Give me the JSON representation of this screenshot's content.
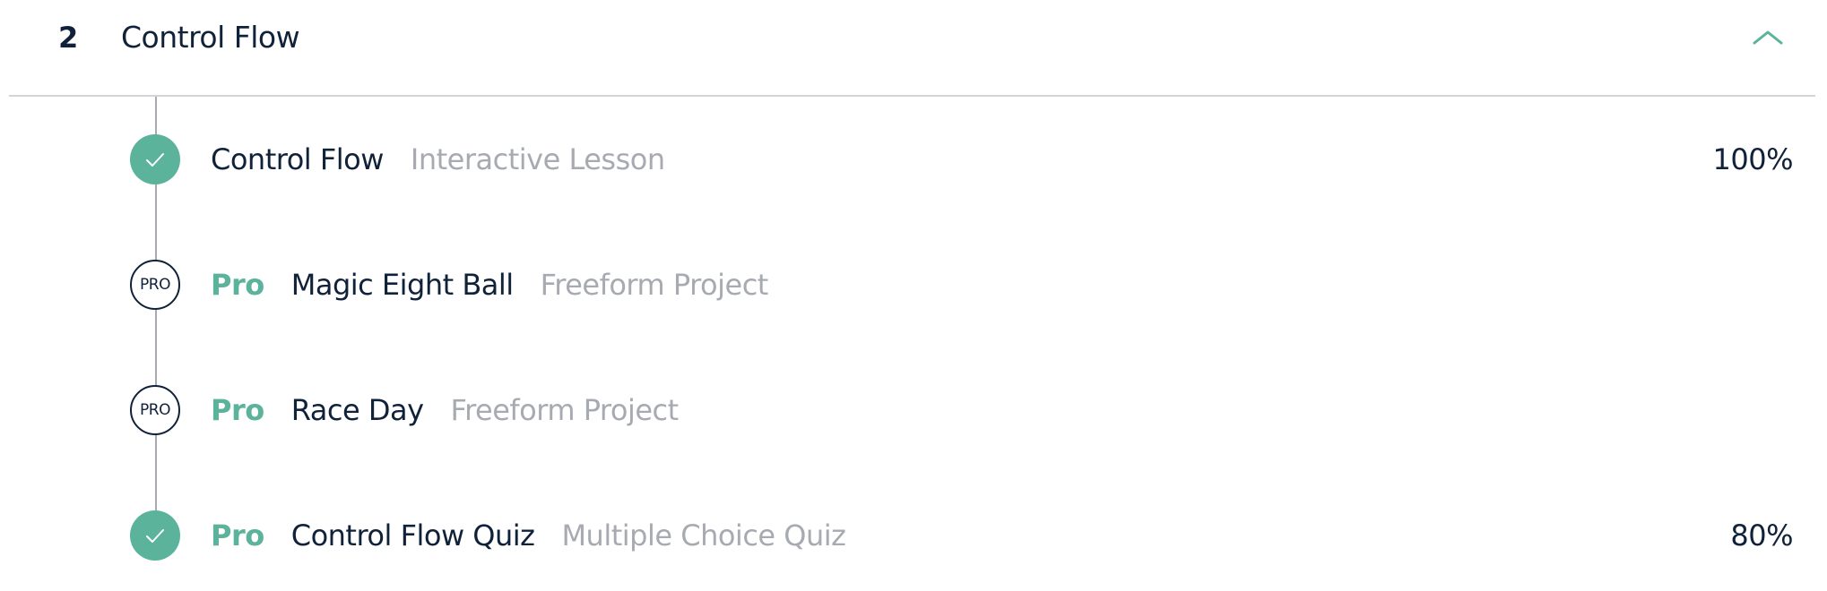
{
  "section": {
    "number": "2",
    "title": "Control Flow",
    "toggle_icon": "chevron-up-icon"
  },
  "lessons": [
    {
      "status": "complete",
      "status_icon": "checkmark-icon",
      "pro_label": "",
      "title": "Control Flow",
      "type": "Interactive Lesson",
      "progress": "100%"
    },
    {
      "status": "pro",
      "status_icon": "pro-badge-icon",
      "badge_text": "PRO",
      "pro_label": "Pro",
      "title": "Magic Eight Ball",
      "type": "Freeform Project",
      "progress": ""
    },
    {
      "status": "pro",
      "status_icon": "pro-badge-icon",
      "badge_text": "PRO",
      "pro_label": "Pro",
      "title": "Race Day",
      "type": "Freeform Project",
      "progress": ""
    },
    {
      "status": "complete",
      "status_icon": "checkmark-icon",
      "pro_label": "Pro",
      "title": "Control Flow Quiz",
      "type": "Multiple Choice Quiz",
      "progress": "80%"
    }
  ],
  "colors": {
    "accent": "#5bb39c",
    "text_primary": "#10223a",
    "text_muted": "#a7abb1",
    "divider": "#d3d5d8"
  }
}
